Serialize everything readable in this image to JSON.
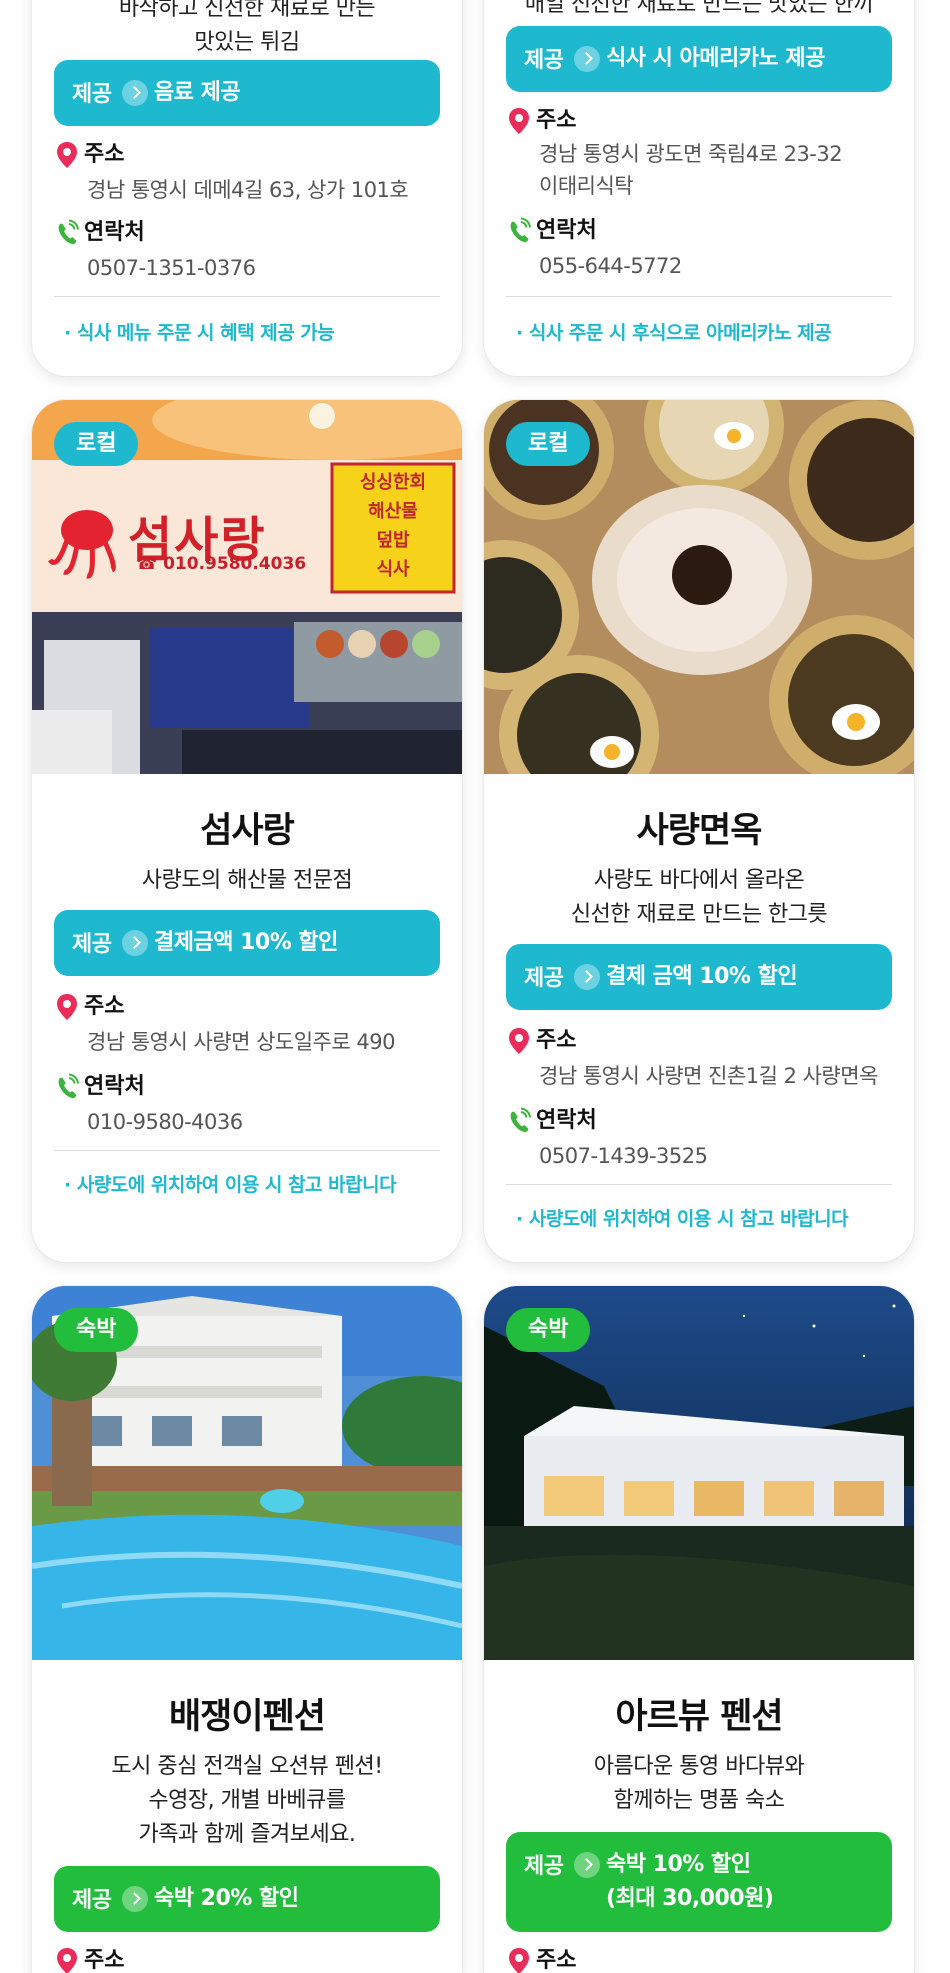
{
  "top_row": {
    "left": {
      "desc_lines": [
        "바삭하고 신선한 재료로 만든",
        "맛있는 튀김"
      ],
      "offer_label": "제공",
      "offer_text": "음료 제공",
      "address_label": "주소",
      "address": "경남 통영시 데메4길 63, 상가 101호",
      "contact_label": "연락처",
      "phone": "0507-1351-0376",
      "note": "· 식사 메뉴 주문 시 혜택 제공 가능"
    },
    "right": {
      "desc_lines": [
        "매일 신선한 재료로 만드는 맛있는 한끼"
      ],
      "offer_label": "제공",
      "offer_text": "식사 시 아메리카노 제공",
      "address_label": "주소",
      "address_lines": [
        "경남 통영시 광도면 죽림4로 23-32",
        "이태리식탁"
      ],
      "contact_label": "연락처",
      "phone": "055-644-5772",
      "note": "· 식사 주문 시 후식으로 아메리카노 제공"
    }
  },
  "middle_row": {
    "left": {
      "category": "로컬",
      "sign_text": "섬사랑",
      "sign_phone": "☎ 010.9580.4036",
      "sign_panel": [
        "싱싱한회",
        "해산물",
        "덮밥",
        "식사"
      ],
      "name": "섬사랑",
      "desc_lines": [
        "사량도의 해산물 전문점"
      ],
      "offer_label": "제공",
      "offer_text": "결제금액 10% 할인",
      "address_label": "주소",
      "address": "경남 통영시 사량면 상도일주로 490",
      "contact_label": "연락처",
      "phone": "010-9580-4036",
      "note": "· 사량도에 위치하여 이용 시 참고 바랍니다"
    },
    "right": {
      "category": "로컬",
      "name": "사량면옥",
      "desc_lines": [
        "사량도 바다에서 올라온",
        "신선한 재료로 만드는 한그릇"
      ],
      "offer_label": "제공",
      "offer_text": "결제 금액 10% 할인",
      "address_label": "주소",
      "address": "경남 통영시 사량면 진촌1길 2 사량면옥",
      "contact_label": "연락처",
      "phone": "0507-1439-3525",
      "note": "· 사량도에 위치하여 이용 시 참고 바랍니다"
    }
  },
  "bottom_row": {
    "left": {
      "category": "숙박",
      "name": "배쟁이펜션",
      "desc_lines": [
        "도시 중심 전객실 오션뷰 펜션!",
        "수영장, 개별 바베큐를",
        "가족과 함께 즐겨보세요."
      ],
      "offer_label": "제공",
      "offer_text": "숙박 20% 할인",
      "address_label": "주소"
    },
    "right": {
      "category": "숙박",
      "name": "아르뷰 펜션",
      "desc_lines": [
        "아름다운 통영 바다뷰와",
        "함께하는 명품 숙소"
      ],
      "offer_label": "제공",
      "offer_lines": [
        "숙박 10% 할인",
        "(최대 30,000원)"
      ],
      "address_label": "주소"
    }
  },
  "colors": {
    "local_accent": "#1eb8cf",
    "stay_accent": "#22bd3d",
    "pin_icon": "#ea2c5a",
    "phone_icon": "#3cb43c"
  },
  "icons": [
    "location-pin-icon",
    "phone-icon",
    "chevron-right-icon"
  ]
}
